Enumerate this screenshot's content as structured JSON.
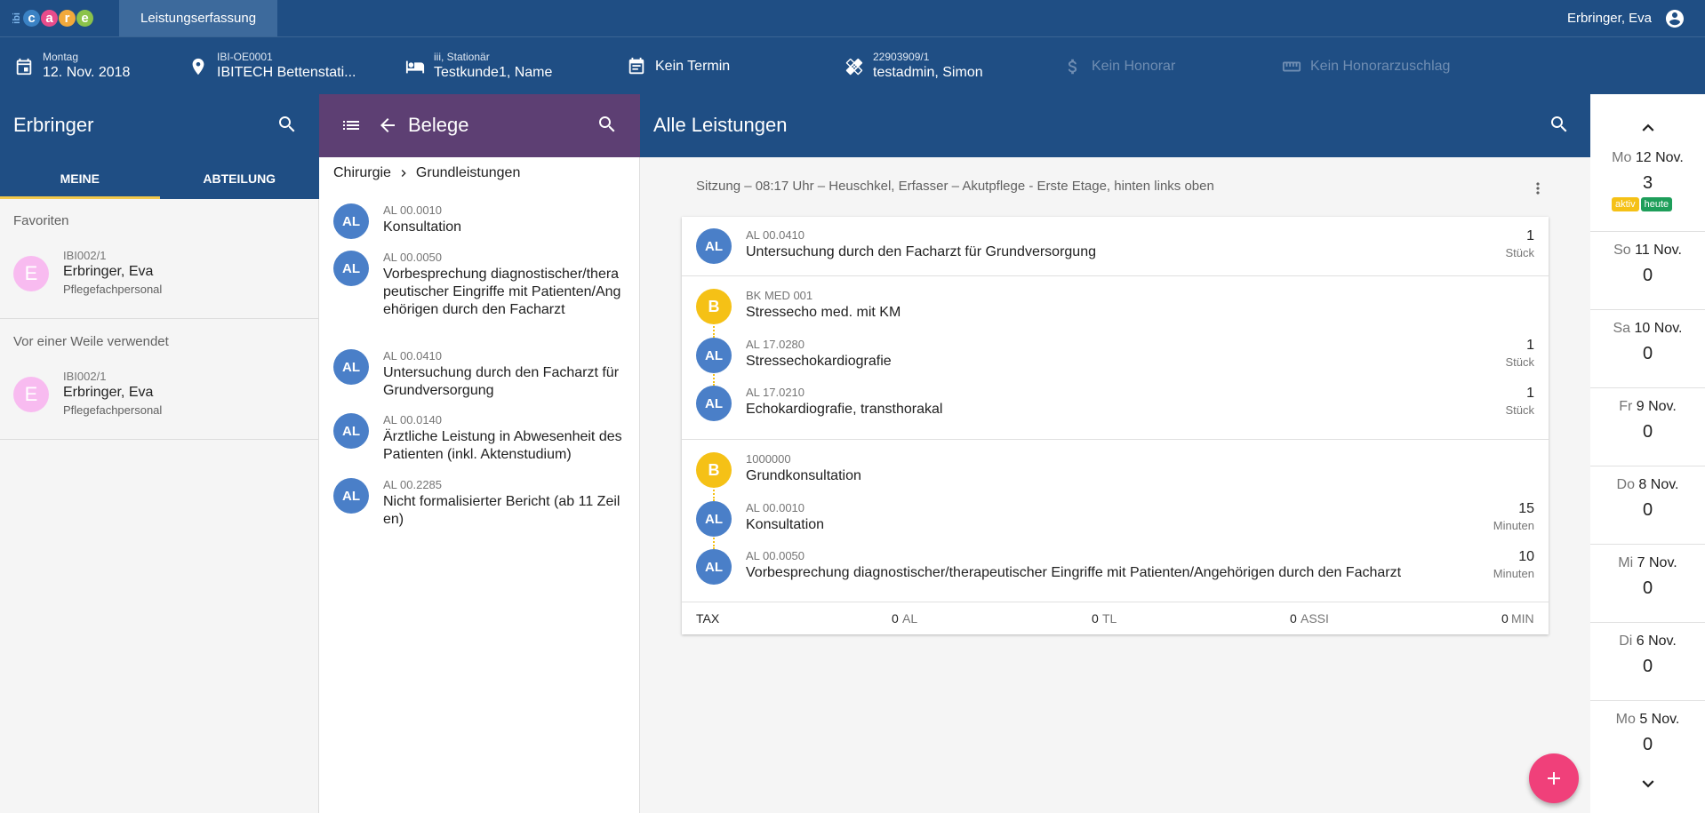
{
  "topbar": {
    "logo_prefix": "ibi",
    "logo_letters": [
      "c",
      "a",
      "r",
      "e"
    ],
    "logo_colors": [
      "#3b82c4",
      "#e84c8b",
      "#f2a93b",
      "#8bc34a"
    ],
    "app_tab": "Leistungserfassung",
    "user_name": "Erbringer, Eva"
  },
  "infobar": {
    "date_label": "Montag",
    "date_value": "12. Nov. 2018",
    "location_label": "IBI-OE0001",
    "location_value": "IBITECH Bettenstati...",
    "stay_label": "iii, Stationär",
    "stay_value": "Testkunde1, Name",
    "appointment": "Kein Termin",
    "case_label": "22903909/1",
    "case_value": "testadmin, Simon",
    "fee": "Kein Honorar",
    "fee_surcharge": "Kein Honorarzuschlag"
  },
  "erbringer": {
    "title": "Erbringer",
    "tabs": [
      "MEINE",
      "ABTEILUNG"
    ],
    "favorites_label": "Favoriten",
    "favorite": {
      "initial": "E",
      "code": "IBI002/1",
      "name": "Erbringer, Eva",
      "role": "Pflegefachpersonal"
    },
    "recent_label": "Vor einer Weile verwendet",
    "recent": {
      "initial": "E",
      "code": "IBI002/1",
      "name": "Erbringer, Eva",
      "role": "Pflegefachpersonal"
    }
  },
  "belege": {
    "title": "Belege",
    "breadcrumb": [
      "Chirurgie",
      "Grundleistungen"
    ],
    "items": [
      {
        "avatar": "AL",
        "code": "AL 00.0010",
        "name": "Konsultation"
      },
      {
        "avatar": "AL",
        "code": "AL 00.0050",
        "name": "Vorbesprechung diagnostischer/therapeutischer Eingriffe mit Patienten/Angehörigen durch den Facharzt"
      },
      {
        "avatar": "AL",
        "code": "AL 00.0410",
        "name": "Untersuchung durch den Facharzt für Grundversorgung"
      },
      {
        "avatar": "AL",
        "code": "AL 00.0140",
        "name": "Ärztliche Leistung in Abwesenheit des Patienten (inkl. Aktenstudium)"
      },
      {
        "avatar": "AL",
        "code": "AL 00.2285",
        "name": "Nicht formalisierter Bericht (ab 11 Zeilen)"
      }
    ]
  },
  "main": {
    "title": "Alle Leistungen",
    "session": "Sitzung – 08:17 Uhr – Heuschkel, Erfasser – Akutpflege - Erste Etage, hinten links oben",
    "rows": [
      {
        "avatar": "AL",
        "code": "AL 00.0410",
        "name": "Untersuchung durch den Facharzt für Grundversorgung",
        "qty": "1",
        "unit": "Stück"
      },
      {
        "avatar": "B",
        "code": "BK MED 001",
        "name": "Stressecho med. mit KM",
        "qty": "",
        "unit": ""
      },
      {
        "avatar": "AL",
        "code": "AL 17.0280",
        "name": "Stressechokardiografie",
        "qty": "1",
        "unit": "Stück"
      },
      {
        "avatar": "AL",
        "code": "AL 17.0210",
        "name": "Echokardiografie, transthorakal",
        "qty": "1",
        "unit": "Stück"
      },
      {
        "avatar": "B",
        "code": "1000000",
        "name": "Grundkonsultation",
        "qty": "",
        "unit": ""
      },
      {
        "avatar": "AL",
        "code": "AL 00.0010",
        "name": "Konsultation",
        "qty": "15",
        "unit": "Minuten"
      },
      {
        "avatar": "AL",
        "code": "AL 00.0050",
        "name": "Vorbesprechung diagnostischer/therapeutischer Eingriffe mit Patienten/Angehörigen durch den Facharzt",
        "qty": "10",
        "unit": "Minuten"
      }
    ],
    "summary": {
      "label": "TAX",
      "al_value": "0",
      "al_unit": "AL",
      "tl_value": "0",
      "tl_unit": "TL",
      "assi_value": "0",
      "assi_unit": "ASSI",
      "min_value": "0",
      "min_unit": "MIN"
    }
  },
  "calendar": {
    "days": [
      {
        "weekday": "Mo",
        "date": "12 Nov.",
        "count": "3"
      },
      {
        "weekday": "So",
        "date": "11 Nov.",
        "count": "0"
      },
      {
        "weekday": "Sa",
        "date": "10 Nov.",
        "count": "0"
      },
      {
        "weekday": "Fr",
        "date": "9 Nov.",
        "count": "0"
      },
      {
        "weekday": "Do",
        "date": "8 Nov.",
        "count": "0"
      },
      {
        "weekday": "Mi",
        "date": "7 Nov.",
        "count": "0"
      },
      {
        "weekday": "Di",
        "date": "6 Nov.",
        "count": "0"
      },
      {
        "weekday": "Mo",
        "date": "5 Nov.",
        "count": "0"
      }
    ],
    "badge_active": "aktiv",
    "badge_today": "heute",
    "badge_active_color": "#f5c116",
    "badge_today_color": "#1e9e5a"
  },
  "colors": {
    "primary": "#1f4e84",
    "belege_header": "#5d3f73",
    "fab": "#f0407a",
    "avatar_al": "#4a7fc8",
    "avatar_b": "#f5c116"
  }
}
